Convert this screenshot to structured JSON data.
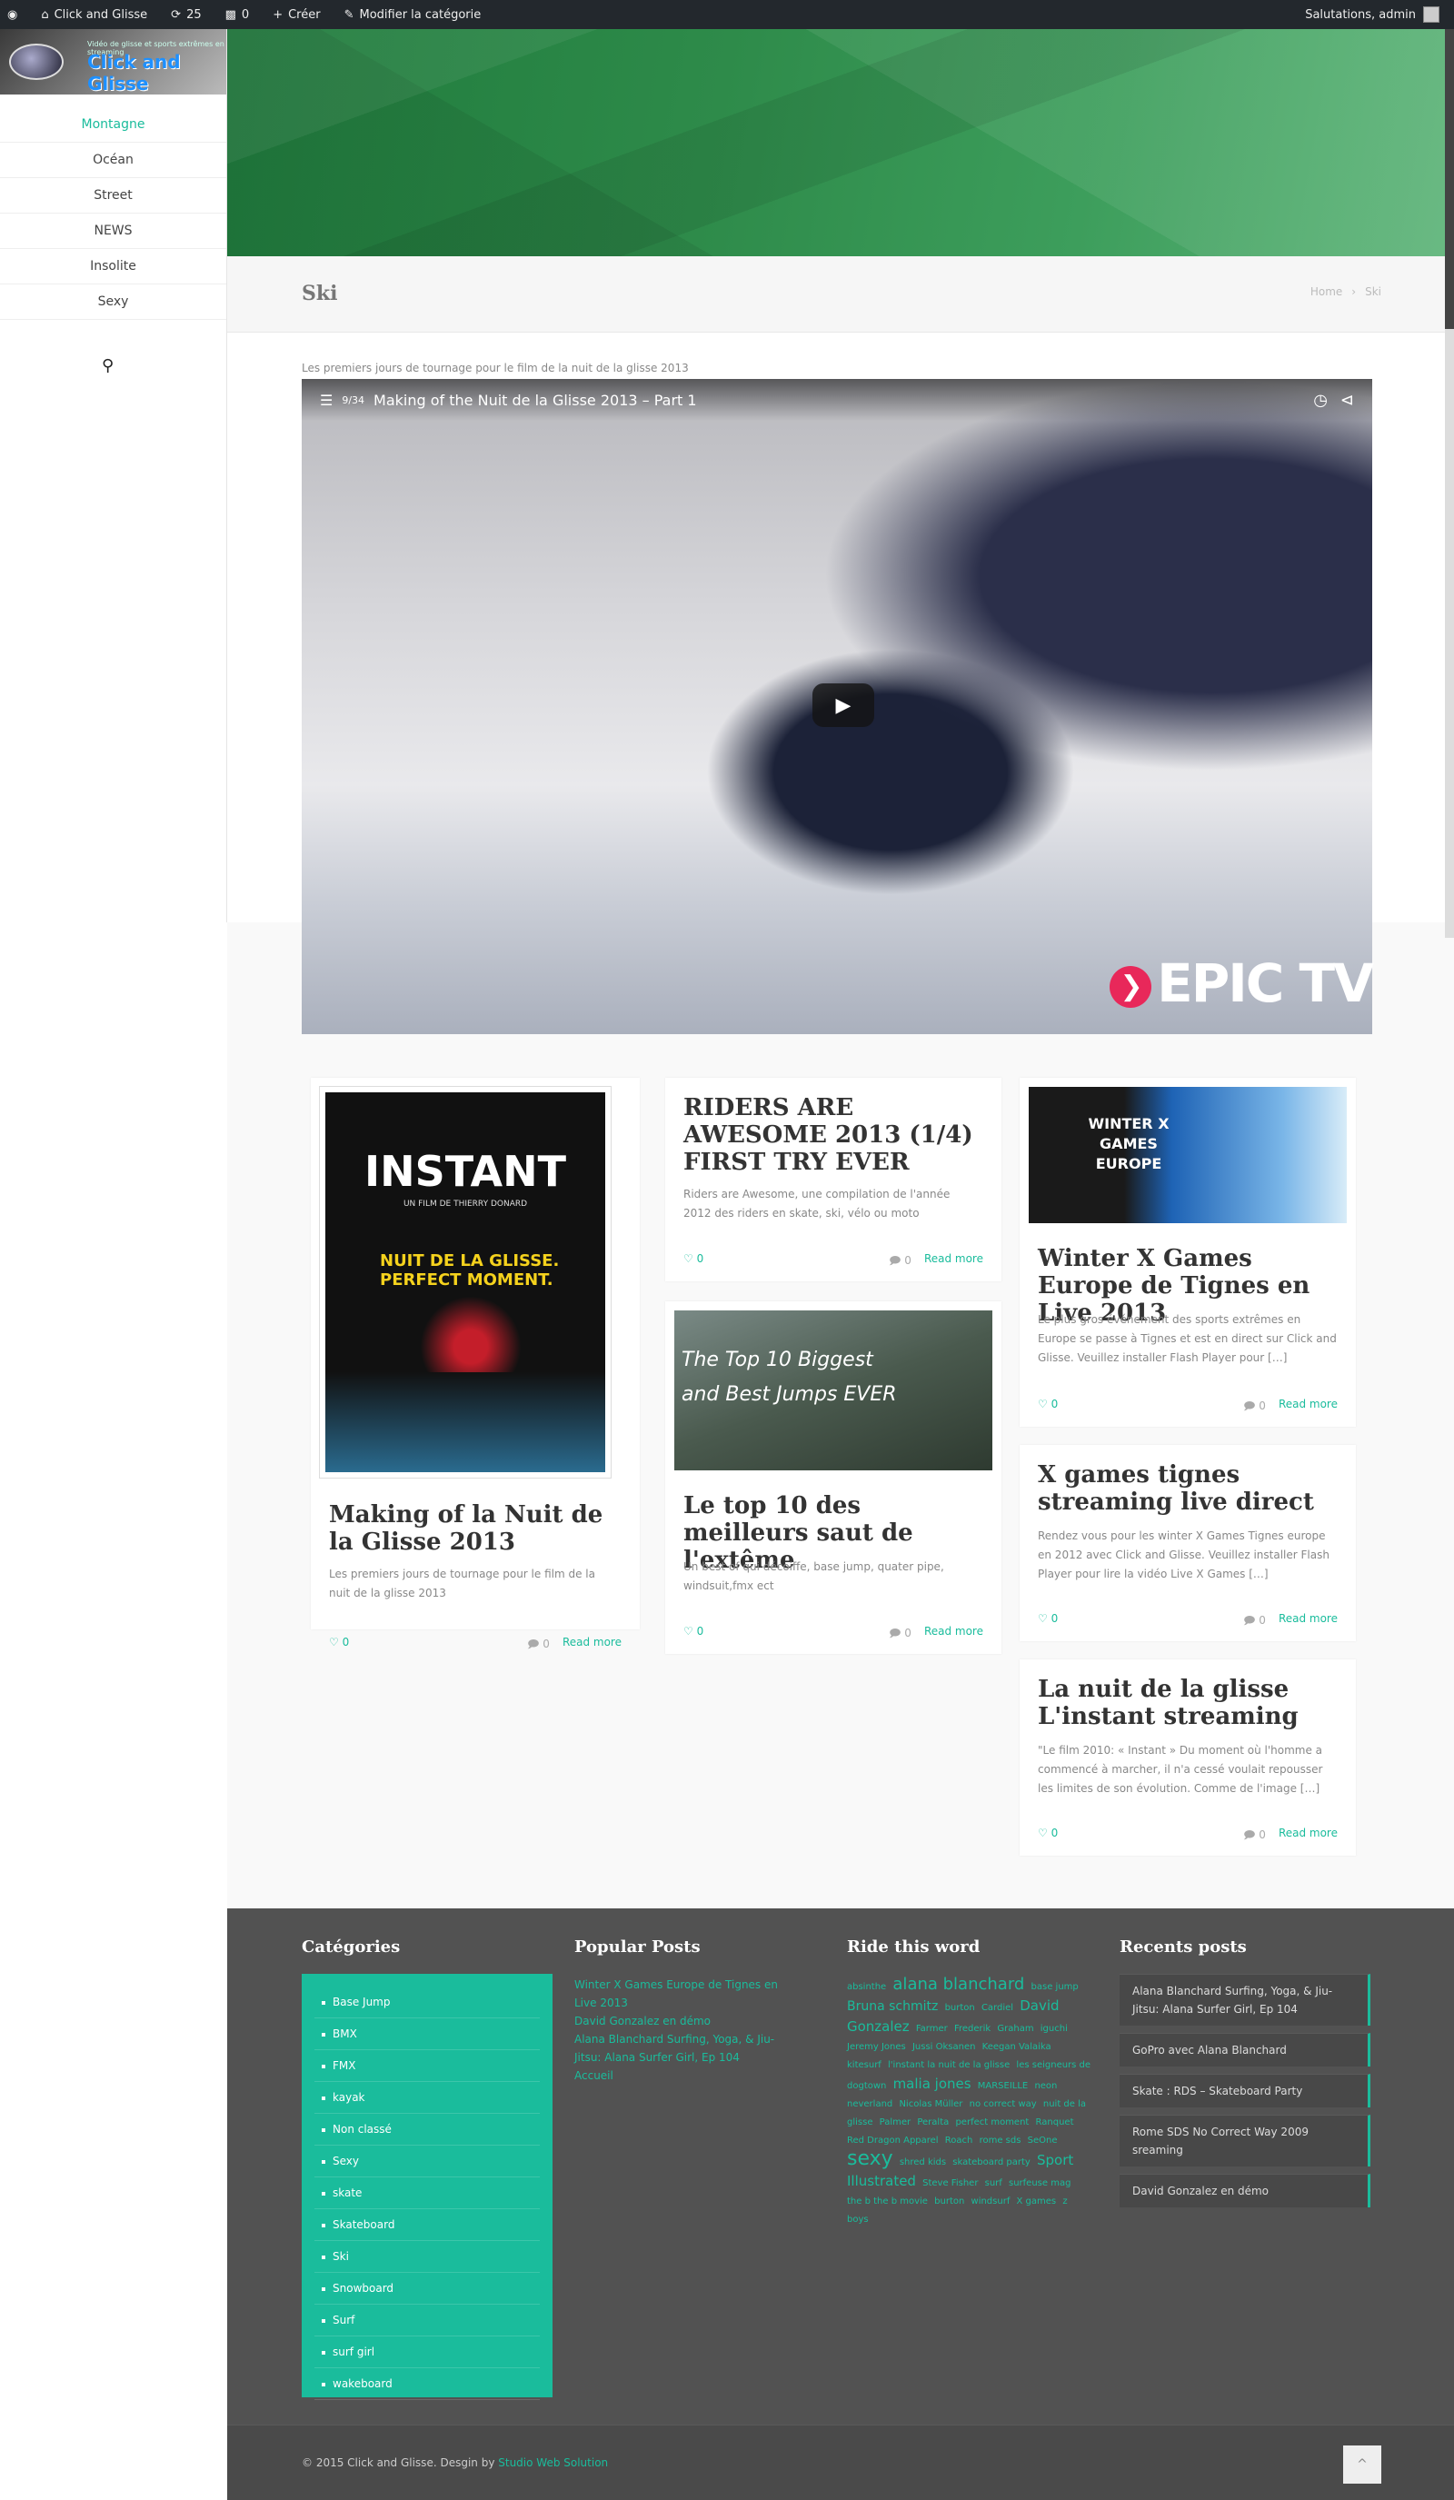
{
  "adminbar": {
    "site": "Click and Glisse",
    "updates": "25",
    "comments": "0",
    "create": "Créer",
    "edit": "Modifier la catégorie",
    "greeting": "Salutations, admin"
  },
  "logo": {
    "tagline": "Vidéo de glisse et sports extrêmes en streaming",
    "name": "Click and Glisse"
  },
  "nav": [
    "Montagne",
    "Océan",
    "Street",
    "NEWS",
    "Insolite",
    "Sexy"
  ],
  "page": {
    "title": "Ski",
    "breadcrumb_home": "Home",
    "breadcrumb_sep": "›",
    "breadcrumb_current": "Ski"
  },
  "video": {
    "caption": "Les premiers jours de tournage pour le film de la nuit de la glisse 2013",
    "counter": "9/34",
    "title": "Making of the Nuit de la Glisse 2013 – Part 1",
    "watermark": "EPIC TV"
  },
  "cards": [
    {
      "title": "Making of la Nuit de la Glisse 2013",
      "excerpt": "Les premiers jours de tournage pour le film de la nuit de la glisse 2013",
      "likes": "0",
      "comments": "0",
      "more": "Read more",
      "poster": "INSTANT",
      "poster_sub": "UN FILM DE THIERRY DONARD",
      "poster_brand": "NUIT DE LA GLISSE. PERFECT MOMENT."
    },
    {
      "title": "RIDERS ARE AWESOME 2013 (1/4) FIRST TRY EVER",
      "excerpt": "Riders are Awesome, une compilation de l'année 2012 des riders en skate, ski, vélo ou moto",
      "likes": "0",
      "comments": "0",
      "more": "Read more"
    },
    {
      "title": "Le top 10 des meilleurs saut de l'extême",
      "excerpt": "Un best of qui décoiffe, base jump, quater pipe, windsuit,fmx ect",
      "likes": "0",
      "comments": "0",
      "more": "Read more",
      "thumb_text": "The Top 10 Biggest and Best Jumps EVER"
    },
    {
      "title": "Winter X Games Europe de Tignes en Live 2013",
      "excerpt": "Le plus gros événement des sports extrêmes en Europe se passe à Tignes et est en direct sur Click and Glisse. Veuillez installer Flash Player pour […]",
      "likes": "0",
      "comments": "0",
      "more": "Read more",
      "thumb_text": "WINTER X GAMES EUROPE"
    },
    {
      "title": "X games tignes streaming live direct",
      "excerpt": "Rendez vous pour les winter X Games Tignes europe en 2012 avec Click and Glisse. Veuillez installer Flash Player pour lire la vidéo Live X Games […]",
      "likes": "0",
      "comments": "0",
      "more": "Read more"
    },
    {
      "title": "La nuit de la glisse L'instant streaming",
      "excerpt": "\"Le film 2010: « Instant » Du moment où l'homme a commencé à marcher, il n'a cessé voulait repousser les limites de son évolution. Comme de l'image […]",
      "likes": "0",
      "comments": "0",
      "more": "Read more"
    }
  ],
  "footer": {
    "cat_title": "Catégories",
    "categories": [
      "Base Jump",
      "BMX",
      "FMX",
      "kayak",
      "Non classé",
      "Sexy",
      "skate",
      "Skateboard",
      "Ski",
      "Snowboard",
      "Surf",
      "surf girl",
      "wakeboard"
    ],
    "pop_title": "Popular Posts",
    "popular": [
      "Winter X Games Europe de Tignes en Live 2013",
      "David Gonzalez en démo",
      "Alana Blanchard Surfing, Yoga, & Jiu-Jitsu: Alana Surfer Girl, Ep 104",
      "Accueil"
    ],
    "tags_title": "Ride this word",
    "tags": [
      "absinthe",
      "alana blanchard",
      "base jump",
      "Bruna schmitz",
      "burton",
      "Cardiel",
      "David Gonzalez",
      "Farmer",
      "Frederik",
      "Graham",
      "iguchi",
      "Jeremy Jones",
      "Jussi Oksanen",
      "Keegan Valaika",
      "kitesurf",
      "l'instant la nuit de la glisse",
      "les seigneurs de dogtown",
      "malia jones",
      "MARSEILLE",
      "neon neverland",
      "Nicolas Müller",
      "no correct way",
      "nuit de la glisse",
      "Palmer",
      "Peralta",
      "perfect moment",
      "Ranquet",
      "Red Dragon Apparel",
      "Roach",
      "rome sds",
      "SeOne",
      "sexy",
      "shred kids",
      "skateboard party",
      "Sport Illustrated",
      "Steve Fisher",
      "surf",
      "surfeuse mag",
      "the b the b movie",
      "burton",
      "windsurf",
      "X games",
      "z boys"
    ],
    "recent_title": "Recents posts",
    "recent": [
      "Alana Blanchard Surfing, Yoga, & Jiu-Jitsu: Alana Surfer Girl, Ep 104",
      "GoPro avec Alana Blanchard",
      "Skate : RDS – Skateboard Party",
      "Rome SDS No Correct Way 2009 sreaming",
      "David Gonzalez en démo"
    ],
    "copyright": "© 2015 Click and Glisse. Desgin by",
    "designer": "Studio Web Solution",
    "top": "^"
  }
}
